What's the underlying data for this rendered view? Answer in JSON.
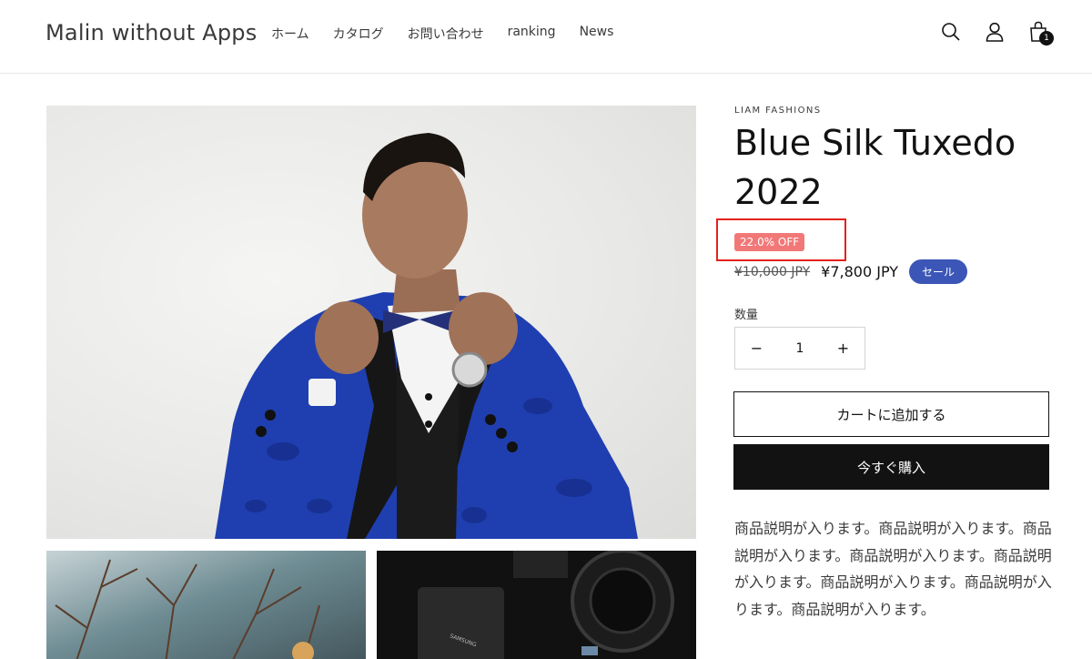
{
  "header": {
    "logo": "Malin without Apps",
    "nav": [
      "ホーム",
      "カタログ",
      "お問い合わせ",
      "ranking",
      "News"
    ],
    "cart_count": "1",
    "icons": [
      "search-icon",
      "account-icon",
      "cart-icon"
    ]
  },
  "product": {
    "vendor": "LIAM FASHIONS",
    "title": "Blue Silk Tuxedo 2022",
    "discount_badge": "22.0% OFF",
    "compare_price": "¥10,000 JPY",
    "price": "¥7,800 JPY",
    "sale_badge": "セール",
    "quantity_label": "数量",
    "quantity_value": "1",
    "quantity_minus": "−",
    "quantity_plus": "+",
    "add_to_cart": "カートに追加する",
    "buy_now": "今すぐ購入",
    "description": "商品説明が入ります。商品説明が入ります。商品説明が入ります。商品説明が入ります。商品説明が入ります。商品説明が入ります。商品説明が入ります。商品説明が入ります。"
  },
  "colors": {
    "discount_badge_bg": "#f27878",
    "highlight_box": "#e4221c",
    "sale_badge_bg": "#3b56b7",
    "primary_button_bg": "#121212"
  }
}
